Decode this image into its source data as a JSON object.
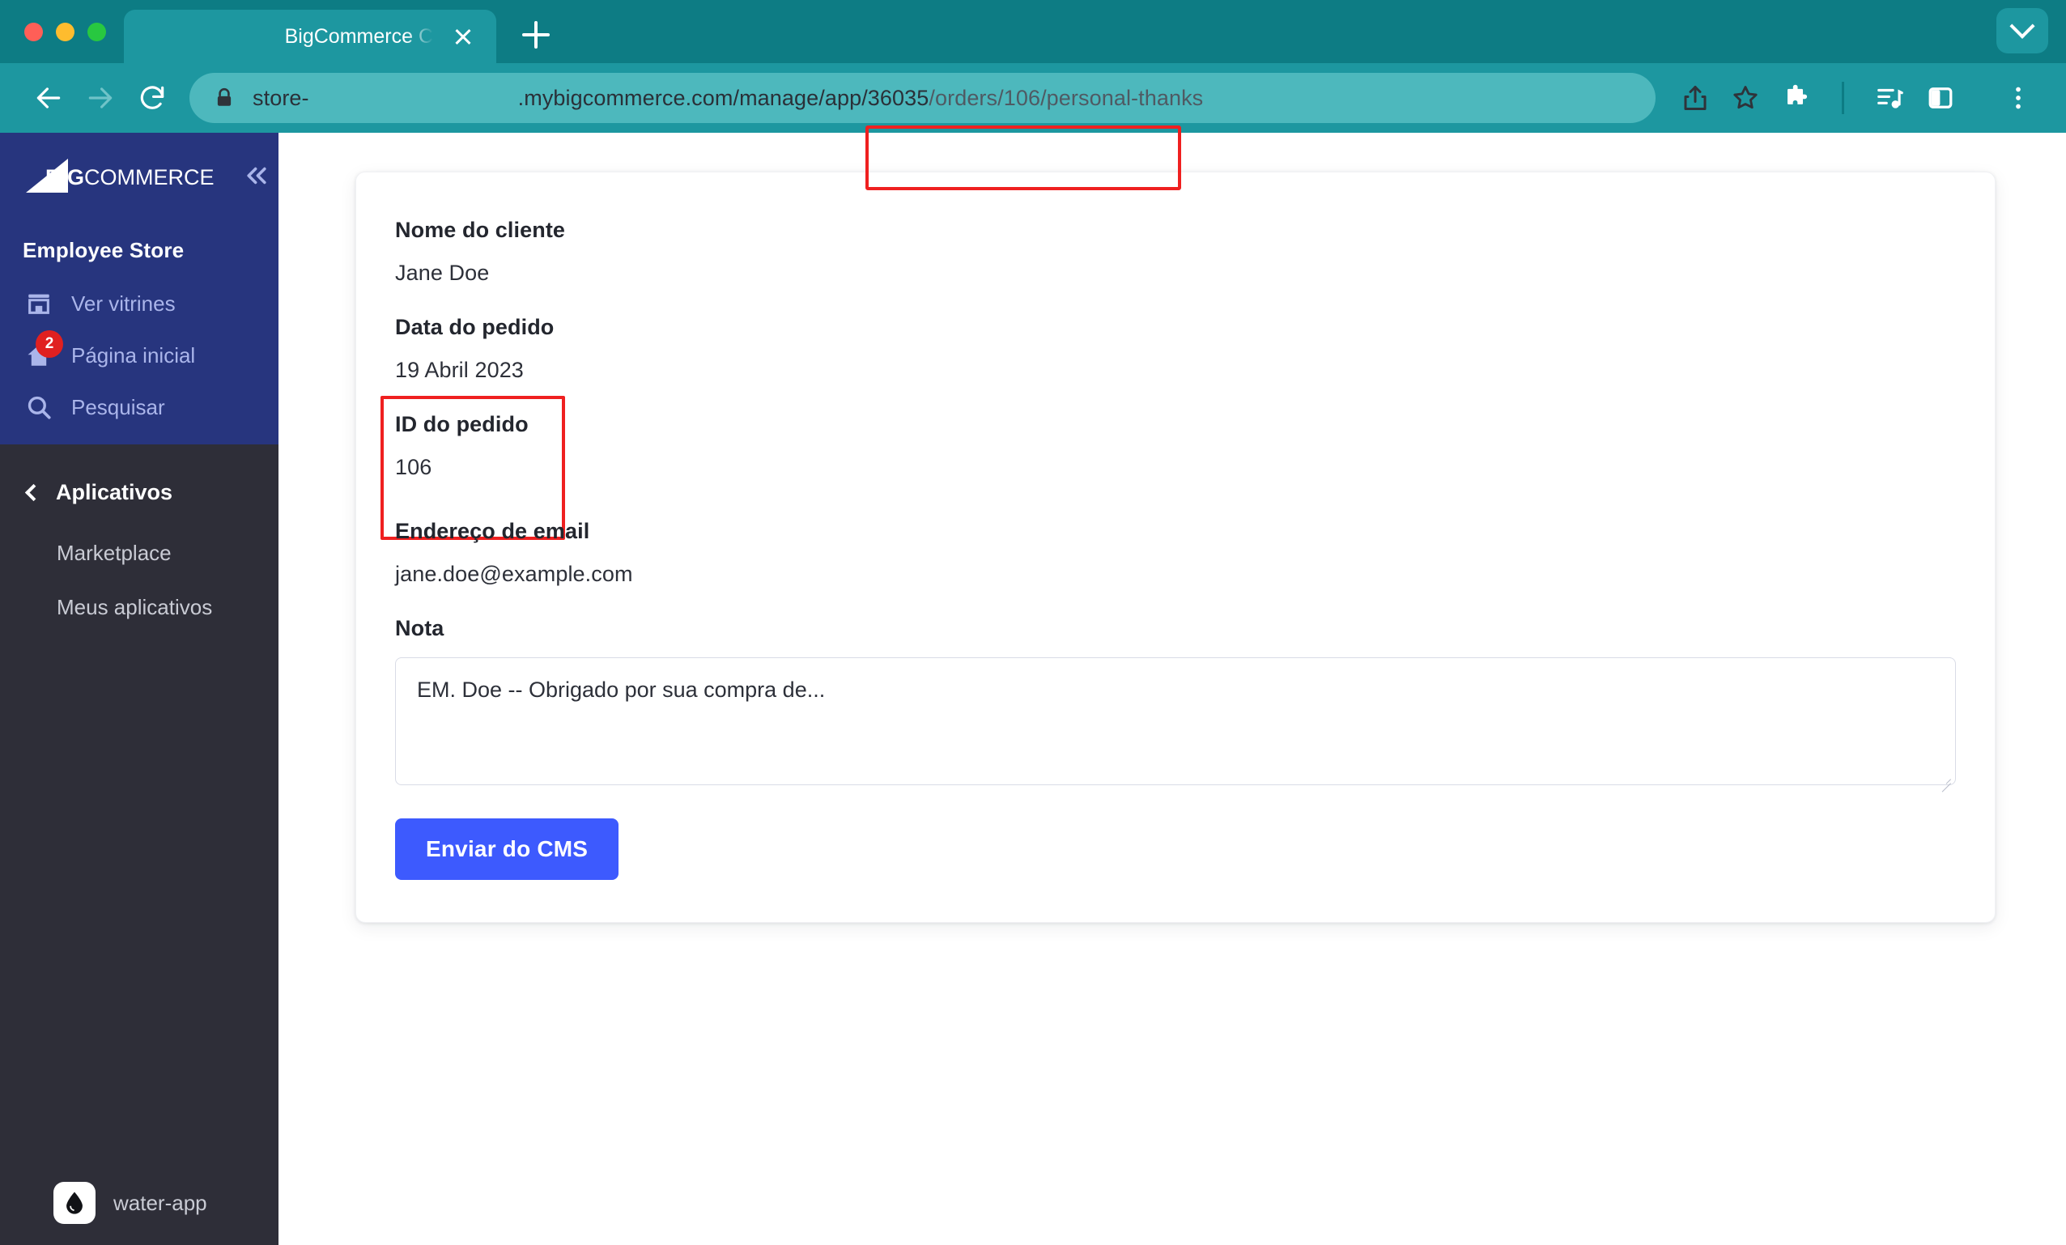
{
  "browser": {
    "tab": {
      "title": "BigCommerce C",
      "close_label": "close-tab"
    },
    "new_tab_label": "+",
    "expand_label": "v",
    "url": {
      "prefix": "store-",
      "middle": ".mybigcommerce.com/manage/app/36035",
      "highlighted": "/orders/106/personal-thanks",
      "full": "store-.mybigcommerce.com/manage/app/36035/orders/106/personal-thanks"
    },
    "toolbar_icons": [
      "back-icon",
      "forward-icon",
      "reload-icon",
      "lock-icon",
      "share-icon",
      "bookmark-star-icon",
      "extensions-puzzle-icon",
      "media-list-icon",
      "side-panel-icon",
      "browser-menu-icon"
    ]
  },
  "sidebar": {
    "logo_text": "BIGCOMMERCE",
    "collapse_label": "collapse-sidebar",
    "store_name": "Employee Store",
    "items": [
      {
        "label": "Ver vitrines",
        "icon": "storefront-icon",
        "badge": null
      },
      {
        "label": "Página inicial",
        "icon": "home-icon",
        "badge": "2"
      },
      {
        "label": "Pesquisar",
        "icon": "search-icon",
        "badge": null
      }
    ],
    "apps_section": {
      "title": "Aplicativos",
      "back_label": "back-chevron",
      "sub_items": [
        {
          "label": "Marketplace"
        },
        {
          "label": "Meus aplicativos"
        }
      ]
    },
    "footer_app": {
      "label": "water-app",
      "icon": "water-drop-icon"
    }
  },
  "main": {
    "fields": [
      {
        "label": "Nome do cliente",
        "value": "Jane Doe"
      },
      {
        "label": "Data do pedido",
        "value": "19 Abril 2023"
      },
      {
        "label": "ID do pedido",
        "value": "106"
      },
      {
        "label": "Endereço de email",
        "value": "jane.doe@example.com"
      }
    ],
    "note": {
      "label": "Nota",
      "value": "EM. Doe -- Obrigado por sua compra de...",
      "placeholder": "EM. Doe -- Obrigado por sua compra de..."
    },
    "submit_label": "Enviar do CMS"
  },
  "annotations": {
    "url_highlight_color": "#ef2020",
    "order_id_highlight_color": "#ef2020"
  },
  "colors": {
    "browser_chrome": "#1d97a0",
    "tabstrip": "#0d7c84",
    "sidebar_top": "#27357e",
    "sidebar_bottom": "#2e2e38",
    "accent_button": "#3d5afe",
    "badge": "#e02020"
  }
}
